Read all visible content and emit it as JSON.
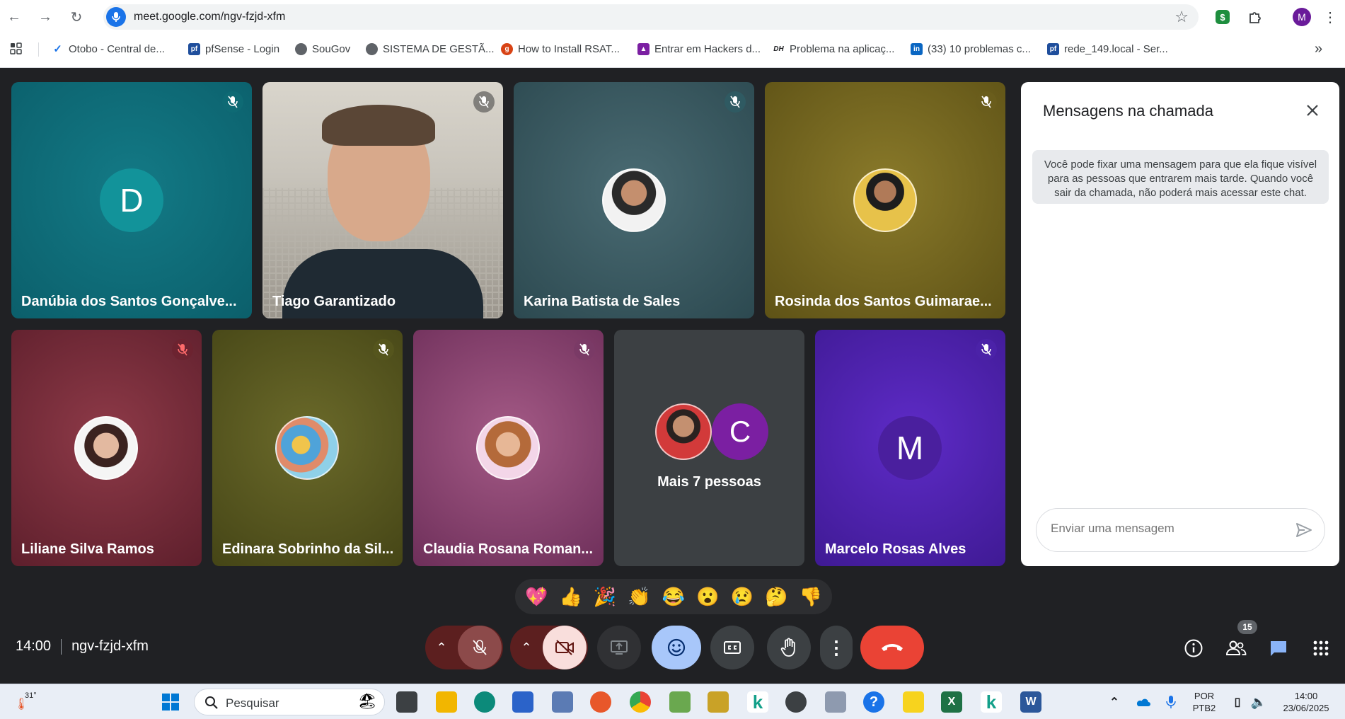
{
  "browser": {
    "url": "meet.google.com/ngv-fzjd-xfm",
    "profile_initial": "M",
    "bookmarks": [
      {
        "label": "Otobo - Central de..."
      },
      {
        "label": "pfSense - Login"
      },
      {
        "label": "SouGov"
      },
      {
        "label": "SISTEMA DE GESTÃ..."
      },
      {
        "label": "How to Install RSAT..."
      },
      {
        "label": "Entrar em Hackers d..."
      },
      {
        "label": "Problema na aplicaç..."
      },
      {
        "label": "(33) 10 problemas c..."
      },
      {
        "label": "rede_149.local - Ser..."
      }
    ]
  },
  "participants": [
    {
      "name": "Danúbia dos Santos Gonçalve...",
      "initial": "D",
      "color": "#12939a"
    },
    {
      "name": "Tiago Garantizado"
    },
    {
      "name": "Karina Batista de Sales"
    },
    {
      "name": "Rosinda dos Santos Guimarae..."
    },
    {
      "name": "Liliane Silva Ramos"
    },
    {
      "name": "Edinara Sobrinho da Sil..."
    },
    {
      "name": "Claudia Rosana Roman..."
    },
    {
      "name": "Mais 7 pessoas",
      "initial": "C"
    },
    {
      "name": "Marcelo Rosas Alves",
      "initial": "M"
    }
  ],
  "chat": {
    "title": "Mensagens na chamada",
    "notice": "Você pode fixar uma mensagem para que ela fique visível para as pessoas que entrarem mais tarde. Quando você sair da chamada, não poderá mais acessar este chat.",
    "placeholder": "Enviar uma mensagem"
  },
  "reactions": [
    "💖",
    "👍",
    "🎉",
    "👏",
    "😂",
    "😮",
    "😢",
    "🤔",
    "👎"
  ],
  "meeting": {
    "time": "14:00",
    "code": "ngv-fzjd-xfm",
    "people_count": "15"
  },
  "taskbar": {
    "weather": "31°",
    "search_label": "Pesquisar",
    "lang_top": "POR",
    "lang_bottom": "PTB2",
    "clock_time": "14:00",
    "clock_date": "23/06/2025"
  },
  "colors": {
    "accent": "#1a73e8",
    "end_call": "#ea4335",
    "muted_ctrl": "#8c2a2a"
  }
}
